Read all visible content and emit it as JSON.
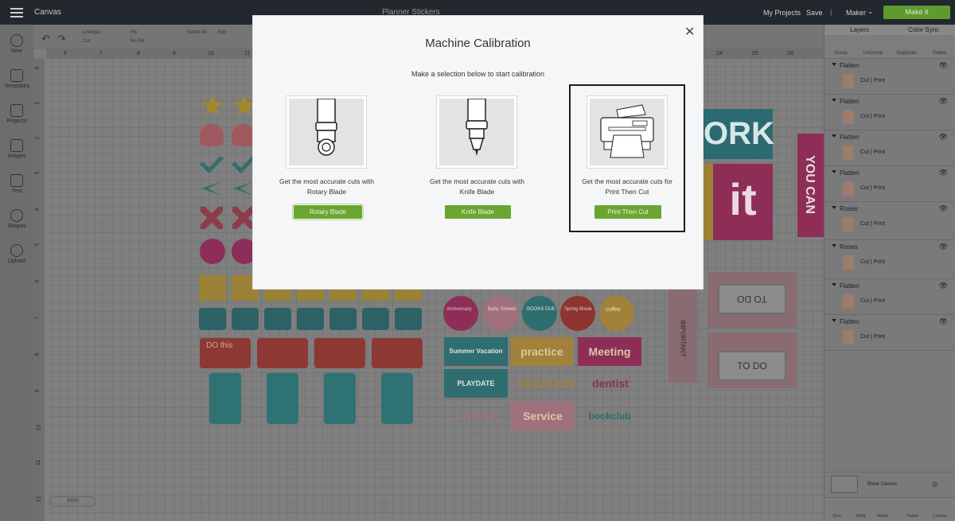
{
  "topbar": {
    "app_title": "Canvas",
    "doc_title": "Planner Stickers",
    "my_projects": "My Projects",
    "save": "Save",
    "separator": "|",
    "machine": "Maker",
    "make": "Make it"
  },
  "rail": [
    {
      "label": "New",
      "icon": "plus-icon"
    },
    {
      "label": "Templates",
      "icon": "shirt-icon"
    },
    {
      "label": "Projects",
      "icon": "projects-icon"
    },
    {
      "label": "Images",
      "icon": "image-icon"
    },
    {
      "label": "Text",
      "icon": "text-icon"
    },
    {
      "label": "Shapes",
      "icon": "shapes-icon"
    },
    {
      "label": "Upload",
      "icon": "upload-icon"
    }
  ],
  "edit_toolbar": {
    "linetype": "Linetype",
    "linetype_value": "Cut",
    "fill": "Fill",
    "fill_value": "No Fill",
    "select_all": "Select All",
    "edit": "Edit"
  },
  "rulers": {
    "top": [
      "6",
      "7",
      "8",
      "9",
      "10",
      "11",
      "24",
      "25",
      "26"
    ],
    "left": [
      "0",
      "1",
      "2",
      "3",
      "4",
      "5",
      "6",
      "7",
      "8",
      "9",
      "10",
      "11",
      "12"
    ]
  },
  "canvas_words": {
    "ork": "ORK",
    "it": "it",
    "you_can": "YOU CAN",
    "important": "IMPORTANT",
    "todo1": "TO DO",
    "todo2": "TO DO",
    "do_this": "DO this",
    "practice": "practice",
    "meeting": "Meeting",
    "vacation": "VACATION",
    "dentist": "dentist",
    "concert": "Concert",
    "service": "Service",
    "bookclub": "bookclub",
    "summer": "Summer Vacation",
    "playdate": "PLAYDATE",
    "baby": "Baby Shower",
    "books": "BOOKS DUE",
    "spring": "Spring Break",
    "coffee": "coffee",
    "anniversary": "Anniversary",
    "zoom": "100%"
  },
  "panel": {
    "tabs": [
      "Layers",
      "Color Sync"
    ],
    "layer_tools": [
      "Group",
      "UnGroup",
      "Duplicate",
      "Delete"
    ],
    "layers": [
      {
        "name": "Flatten",
        "ops": "Cut  |  Print"
      },
      {
        "name": "Flatten",
        "ops": "Cut  |  Print"
      },
      {
        "name": "Flatten",
        "ops": "Cut  |  Print"
      },
      {
        "name": "Flatten",
        "ops": "Cut  |  Print"
      },
      {
        "name": "Roses",
        "ops": "Cut  |  Print"
      },
      {
        "name": "Roses",
        "ops": "Cut  |  Print"
      },
      {
        "name": "Flatten",
        "ops": "Cut  |  Print"
      },
      {
        "name": "Flatten",
        "ops": "Cut  |  Print"
      }
    ],
    "blank_canvas": "Blank Canvas",
    "bottom_tools": [
      "Slice",
      "Weld",
      "Attach",
      "Flatten",
      "Contour"
    ]
  },
  "modal": {
    "title": "Machine Calibration",
    "subtitle": "Make a selection below to start calibration",
    "close": "✕",
    "options": [
      {
        "desc1": "Get the most accurate cuts with",
        "desc2": "Rotary Blade",
        "button": "Rotary Blade"
      },
      {
        "desc1": "Get the most accurate cuts with",
        "desc2": "Knife Blade",
        "button": "Knife Blade"
      },
      {
        "desc1": "Get the most accurate cuts for",
        "desc2": "Print Then Cut",
        "button": "Print Then Cut"
      }
    ]
  },
  "colors": {
    "accent_green": "#6aa631",
    "topbar": "#22282d",
    "modal_bg": "#f5f6f7"
  }
}
